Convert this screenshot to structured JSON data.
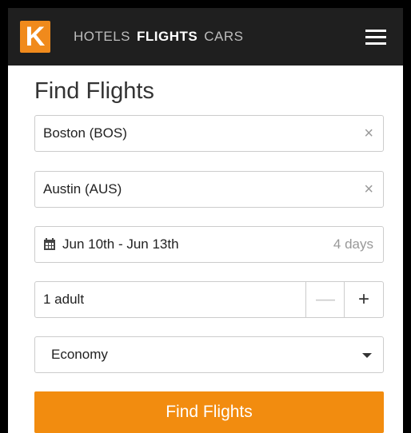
{
  "header": {
    "logo_letter": "K",
    "nav": [
      "HOTELS",
      "FLIGHTS",
      "CARS"
    ],
    "active_nav": "FLIGHTS"
  },
  "form": {
    "title": "Find Flights",
    "origin": "Boston (BOS)",
    "destination": "Austin (AUS)",
    "dates": "Jun 10th - Jun 13th",
    "duration": "4 days",
    "travelers": "1 adult",
    "minus": "—",
    "plus": "+",
    "cabin": "Economy",
    "clear_glyph": "×",
    "submit_label": "Find Flights"
  },
  "colors": {
    "accent": "#f28c0f",
    "topbar": "#1f1f1f"
  },
  "icons": [
    "logo-icon",
    "hamburger-menu-icon",
    "clear-icon",
    "calendar-icon",
    "dropdown-caret-icon"
  ]
}
